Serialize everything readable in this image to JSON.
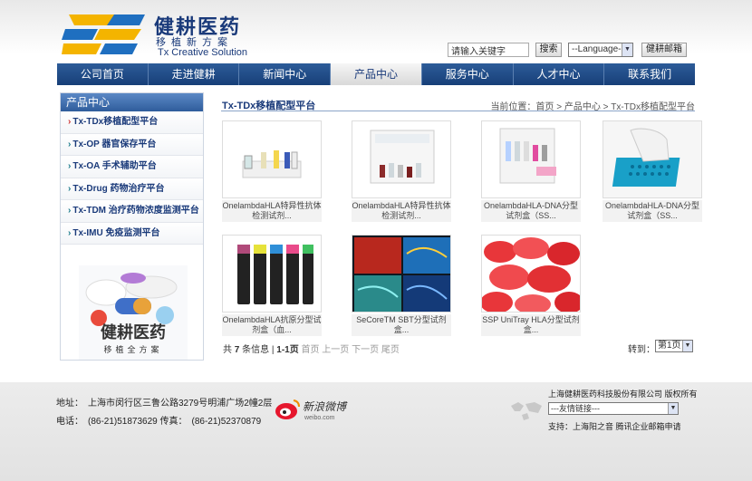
{
  "header": {
    "logo_cn": "健耕医药",
    "logo_sub": "移植新方案",
    "logo_en": "Tx Creative Solution",
    "search_placeholder": "请输入关键字",
    "search_button": "搜索",
    "language_select": "--Language--",
    "mail_button": "健耕邮箱"
  },
  "nav": {
    "items": [
      "公司首页",
      "走进健耕",
      "新闻中心",
      "产品中心",
      "服务中心",
      "人才中心",
      "联系我们"
    ],
    "active": "产品中心"
  },
  "sidebar": {
    "title": "产品中心",
    "items": [
      {
        "label": "Tx-TDx移植配型平台",
        "active": true
      },
      {
        "label": "Tx-OP 器官保存平台"
      },
      {
        "label": "Tx-OA 手术辅助平台"
      },
      {
        "label": "Tx-Drug 药物治疗平台"
      },
      {
        "label": "Tx-TDM 治疗药物浓度监测平台"
      },
      {
        "label": "Tx-IMU 免疫监测平台"
      }
    ],
    "image_text_cn": "健耕医药",
    "image_text_sub": "移植全方案"
  },
  "main": {
    "title": "Tx-TDx移植配型平台",
    "breadcrumb": "当前位置：首页 > 产品中心 > Tx-TDx移植配型平台",
    "products": [
      {
        "caption": "OnelambdaHLA特异性抗体检测试剂..."
      },
      {
        "caption": "OnelambdaHLA特异性抗体检测试剂..."
      },
      {
        "caption": "OnelambdaHLA-DNA分型试剂盒（SS..."
      },
      {
        "caption": "OnelambdaHLA-DNA分型试剂盒（SS..."
      },
      {
        "caption": "OnelambdaHLA抗原分型试剂盒（血..."
      },
      {
        "caption": "SeCoreTM SBT分型试剂盒..."
      },
      {
        "caption": "SSP UniTray HLA分型试剂盒..."
      }
    ],
    "pager": {
      "total_prefix": "共",
      "total_count": "7",
      "total_suffix": "条信息",
      "page_info": "1-1页",
      "links": "首页 上一页 下一页 尾页",
      "goto_label": "转到：",
      "goto_value": "第1页"
    }
  },
  "footer": {
    "address": "地址：　上海市闵行区三鲁公路3279号明浦广场2幢2层",
    "phone": "电话：　(86-21)51873629  传真：　(86-21)52370879",
    "weibo_label": "新浪微博",
    "weibo_domain": "weibo.com",
    "copyright": "上海健耕医药科技股份有限公司 版权所有",
    "friend_links": "---友情链接---",
    "support": "支持：上海阳之音 腾讯企业邮箱申请"
  },
  "colors": {
    "brand_blue": "#1a3a7a",
    "nav_blue": "#2d5c99",
    "logo_yellow": "#f4b400",
    "logo_blue": "#1f6fc0"
  }
}
